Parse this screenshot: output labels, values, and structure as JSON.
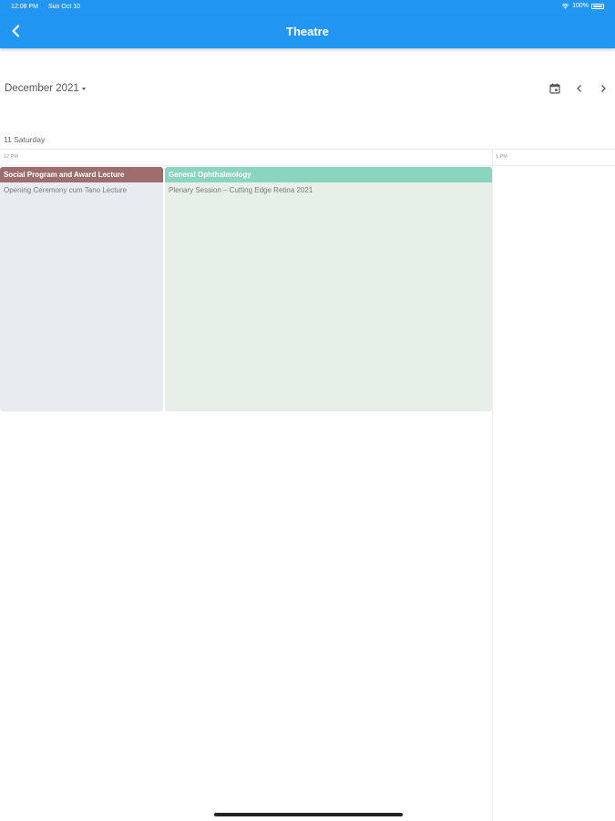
{
  "status_bar": {
    "time": "12:08 PM",
    "date": "Sun Oct 10",
    "battery": "100%"
  },
  "app_bar": {
    "title": "Theatre",
    "back_icon": "chevron-left-icon"
  },
  "toolbar": {
    "month_label": "December 2021",
    "icons": [
      "calendar-icon",
      "chevron-left-icon",
      "chevron-right-icon"
    ]
  },
  "day": {
    "label": "11 Saturday"
  },
  "time_ticks": [
    "12 PM",
    "1 PM"
  ],
  "events": [
    {
      "category": "Social Program and Award Lecture",
      "title": "Opening Ceremony cum Tano Lecture",
      "header_color": "#9e6e6e",
      "body_color": "#e8ecf0"
    },
    {
      "category": "General Ophthalmology",
      "title": "Plenary Session – Cutting Edge Retina 2021",
      "header_color": "#8bd4bd",
      "body_color": "#e7efe9"
    }
  ],
  "colors": {
    "primary": "#2196f3"
  }
}
